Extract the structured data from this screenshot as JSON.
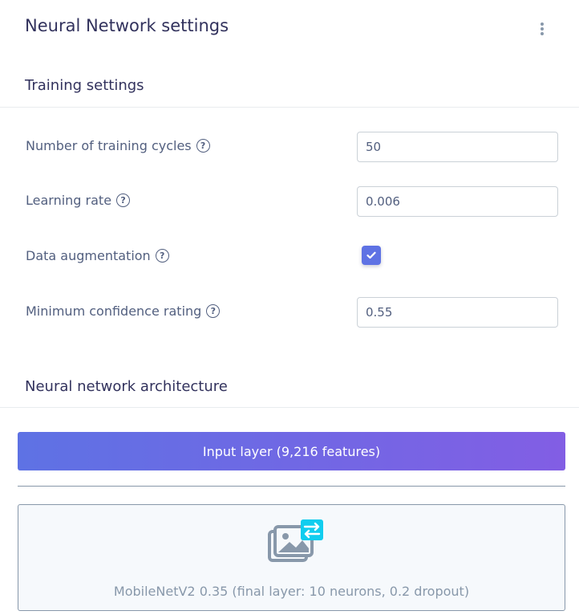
{
  "header": {
    "title": "Neural Network settings",
    "menu_icon": "kebab-vertical-icon"
  },
  "training": {
    "section_title": "Training settings",
    "cycles_label": "Number of training cycles",
    "cycles_value": "50",
    "learning_rate_label": "Learning rate",
    "learning_rate_value": "0.006",
    "augmentation_label": "Data augmentation",
    "augmentation_checked": true,
    "confidence_label": "Minimum confidence rating",
    "confidence_value": "0.55",
    "help_icon": "question-circle-icon",
    "help_glyph": "?"
  },
  "architecture": {
    "section_title": "Neural network architecture",
    "input_layer_label": "Input layer (9,216 features)",
    "model_label": "MobileNetV2 0.35 (final layer: 10 neurons, 0.2 dropout)",
    "model_icon": "image-transfer-icon"
  },
  "colors": {
    "primary": "#5e72e4",
    "gradient_end": "#825ee4",
    "accent_cyan": "#11cdef",
    "text_dark": "#32325d",
    "text_muted": "#8898aa"
  }
}
